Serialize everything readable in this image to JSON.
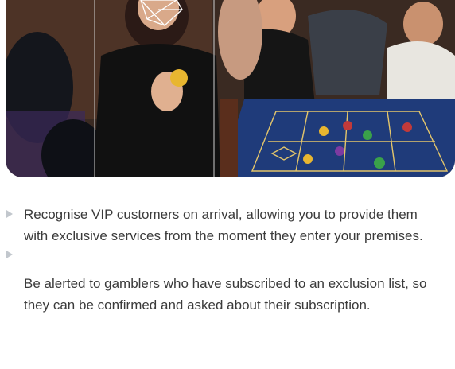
{
  "hero_image": {
    "subject": "casino-roulette-table-face-recognition"
  },
  "bullets": [
    {
      "text": "Recognise VIP customers on arrival, allowing you to provide them with exclusive services from the moment they enter your premises."
    },
    {
      "text": "Be alerted to gamblers who have subscribed to an exclusion list, so they can be confirmed and asked about their subscription."
    }
  ],
  "colors": {
    "text": "#3b3b3b",
    "bullet": "#c2c7cd",
    "table_felt": "#1f3b7a",
    "table_lines": "#e3c56b"
  }
}
